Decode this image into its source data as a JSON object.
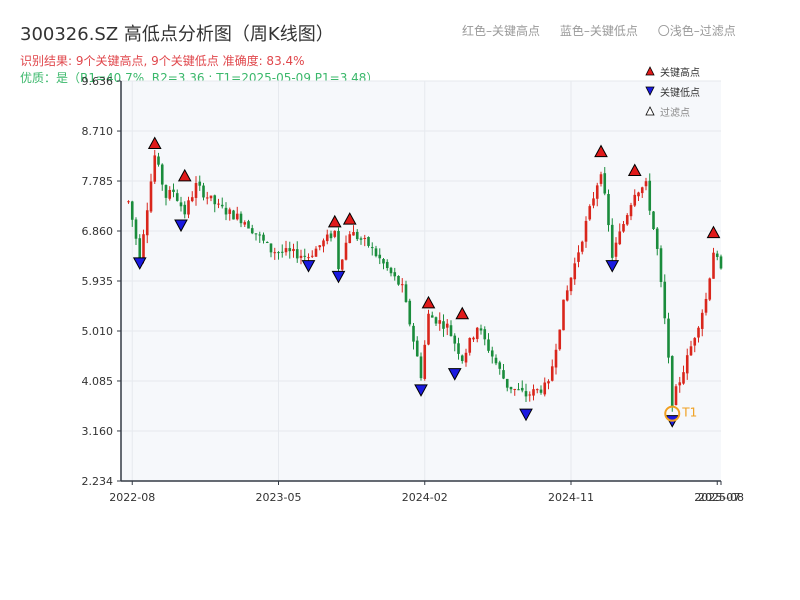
{
  "header": {
    "title": "300326.SZ 高低点分析图（周K线图）",
    "legend": [
      "红色–关键高点",
      "蓝色–关键低点",
      "〇浅色–过滤点"
    ],
    "summary": "识别结果: 9个关键高点, 9个关键低点   准确度: 83.4%",
    "quality": "优质：是（R1=40.7%, R2=3.36 ; T1=2025-05-09 P1=3.48）"
  },
  "chart_data": {
    "type": "candlestick",
    "title": "300326.SZ 高低点分析图（周K线图）",
    "ylim": [
      2.234,
      9.636
    ],
    "yticks": [
      "2.234",
      "3.160",
      "4.085",
      "5.010",
      "5.935",
      "6.860",
      "7.785",
      "8.710",
      "9.636"
    ],
    "xticks": [
      "2022-08",
      "2023-05",
      "2024-02",
      "2024-11",
      "2025-07",
      "2025-08"
    ],
    "grid": true,
    "legend": [
      "关键高点",
      "关键低点",
      "过滤点"
    ],
    "legend_position": "top-right",
    "anchors": [
      [
        "2022-07-29",
        7.4
      ],
      [
        "2022-08-19",
        6.4
      ],
      [
        "2022-09-16",
        8.25
      ],
      [
        "2022-10-07",
        7.5
      ],
      [
        "2022-10-21",
        7.6
      ],
      [
        "2022-11-11",
        7.2
      ],
      [
        "2022-12-02",
        7.7
      ],
      [
        "2023-01-13",
        7.3
      ],
      [
        "2023-03-03",
        7.05
      ],
      [
        "2023-04-21",
        6.5
      ],
      [
        "2023-06-30",
        6.4
      ],
      [
        "2023-08-18",
        6.85
      ],
      [
        "2023-08-25",
        6.2
      ],
      [
        "2023-09-15",
        6.85
      ],
      [
        "2023-10-20",
        6.6
      ],
      [
        "2023-12-22",
        5.8
      ],
      [
        "2024-01-26",
        4.2
      ],
      [
        "2024-02-09",
        5.3
      ],
      [
        "2024-03-15",
        5.1
      ],
      [
        "2024-04-12",
        4.5
      ],
      [
        "2024-05-10",
        5.1
      ],
      [
        "2024-07-05",
        4.0
      ],
      [
        "2024-08-09",
        3.82
      ],
      [
        "2024-09-20",
        4.0
      ],
      [
        "2024-10-18",
        5.5
      ],
      [
        "2024-11-15",
        6.5
      ],
      [
        "2024-12-27",
        8.0
      ],
      [
        "2025-01-17",
        6.4
      ],
      [
        "2025-02-28",
        7.6
      ],
      [
        "2025-03-21",
        7.7
      ],
      [
        "2025-04-11",
        6.5
      ],
      [
        "2025-04-25",
        5.2
      ],
      [
        "2025-05-09",
        3.7
      ],
      [
        "2025-06-06",
        4.5
      ],
      [
        "2025-07-11",
        5.6
      ],
      [
        "2025-07-25",
        6.5
      ],
      [
        "2025-08-08",
        6.1
      ]
    ],
    "key_highs": [
      {
        "date": "2022-09-16",
        "price": 8.35
      },
      {
        "date": "2022-11-11",
        "price": 7.75
      },
      {
        "date": "2023-08-18",
        "price": 6.9
      },
      {
        "date": "2023-09-15",
        "price": 6.95
      },
      {
        "date": "2024-02-09",
        "price": 5.4
      },
      {
        "date": "2024-04-12",
        "price": 5.2
      },
      {
        "date": "2024-12-27",
        "price": 8.2
      },
      {
        "date": "2025-02-28",
        "price": 7.85
      },
      {
        "date": "2025-07-25",
        "price": 6.7
      }
    ],
    "key_lows": [
      {
        "date": "2022-08-19",
        "price": 6.4
      },
      {
        "date": "2022-11-04",
        "price": 7.1
      },
      {
        "date": "2023-06-30",
        "price": 6.35
      },
      {
        "date": "2023-08-25",
        "price": 6.15
      },
      {
        "date": "2024-01-26",
        "price": 4.05
      },
      {
        "date": "2024-03-29",
        "price": 4.35
      },
      {
        "date": "2024-08-09",
        "price": 3.6
      },
      {
        "date": "2025-01-17",
        "price": 6.35
      },
      {
        "date": "2025-05-09",
        "price": 3.48
      }
    ],
    "filtered_points": [
      {
        "date": "2025-05-09",
        "price": 3.48,
        "label": "T1"
      }
    ],
    "colors": {
      "up": "#d9261c",
      "down": "#1a8c3c",
      "high_marker": "#e01a1a",
      "low_marker": "#1a1ae0",
      "filtered_marker": "#f0a020",
      "grid": "#e6e9ee",
      "plot_bg": "#f6f8fb",
      "axis": "#333a45"
    }
  }
}
